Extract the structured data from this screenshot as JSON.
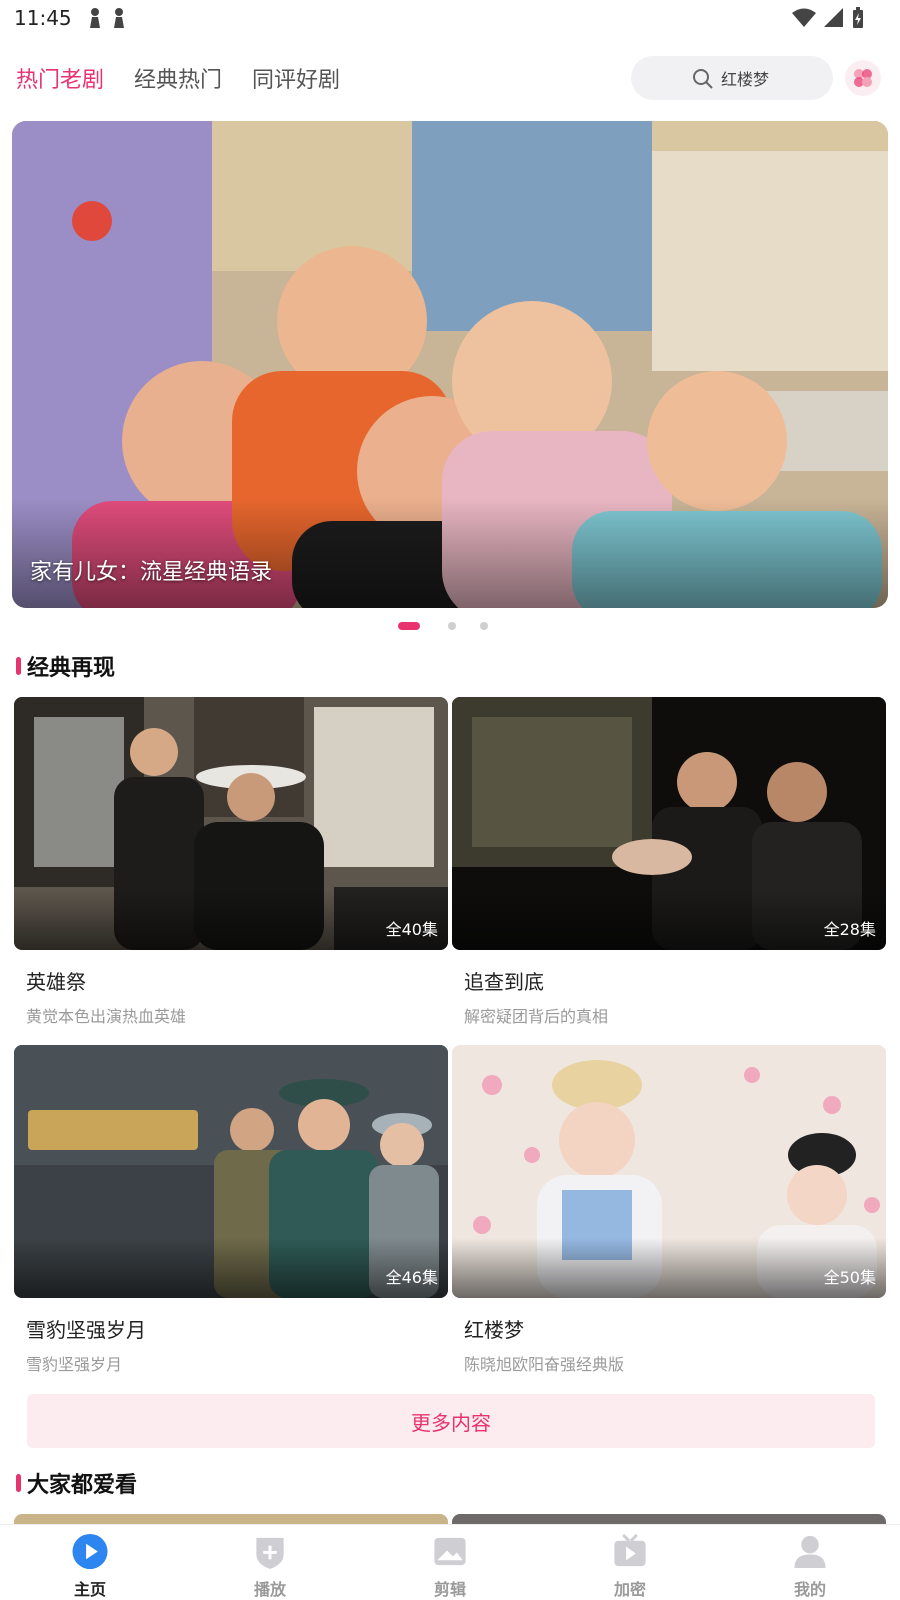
{
  "status_bar": {
    "time": "11:45"
  },
  "top_tabs": [
    {
      "label": "热门老剧",
      "active": true
    },
    {
      "label": "经典热门",
      "active": false
    },
    {
      "label": "同评好剧",
      "active": false
    }
  ],
  "search": {
    "text": "红楼梦"
  },
  "banner": {
    "caption": "家有儿女：流星经典语录",
    "page_count": 3,
    "active_page": 0
  },
  "section_classic": {
    "title": "经典再现"
  },
  "cards": [
    {
      "title": "英雄祭",
      "subtitle": "黄觉本色出演热血英雄",
      "episodes": "全40集"
    },
    {
      "title": "追查到底",
      "subtitle": "解密疑团背后的真相",
      "episodes": "全28集"
    },
    {
      "title": "雪豹坚强岁月",
      "subtitle": "雪豹坚强岁月",
      "episodes": "全46集"
    },
    {
      "title": "红楼梦",
      "subtitle": "陈晓旭欧阳奋强经典版",
      "episodes": "全50集"
    }
  ],
  "more_button": {
    "label": "更多内容"
  },
  "section_popular": {
    "title": "大家都爱看"
  },
  "bottom_nav": [
    {
      "label": "主页",
      "icon": "play-circle-icon",
      "active": true
    },
    {
      "label": "播放",
      "icon": "shield-plus-icon",
      "active": false
    },
    {
      "label": "剪辑",
      "icon": "image-icon",
      "active": false
    },
    {
      "label": "加密",
      "icon": "tv-play-icon",
      "active": false
    },
    {
      "label": "我的",
      "icon": "user-icon",
      "active": false
    }
  ],
  "colors": {
    "accent": "#e8336f",
    "muted": "#9a9a9a"
  }
}
